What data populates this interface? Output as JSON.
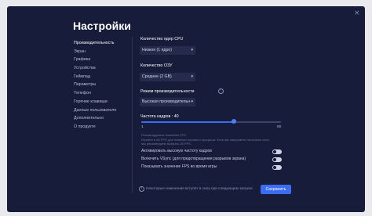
{
  "window": {
    "close_glyph": "×"
  },
  "title": "Настройки",
  "sidebar": {
    "items": [
      {
        "label": "Производительность"
      },
      {
        "label": "Экран"
      },
      {
        "label": "Графика"
      },
      {
        "label": "Устройства"
      },
      {
        "label": "Геймпад"
      },
      {
        "label": "Параметры"
      },
      {
        "label": "Телефон"
      },
      {
        "label": "Горячие клавиши"
      },
      {
        "label": "Данные пользователя"
      },
      {
        "label": "Дополнительно"
      },
      {
        "label": "О продукте"
      }
    ],
    "active_index": 0
  },
  "cpu": {
    "label": "Количество ядер CPU",
    "value": "Низкое (1 ядро)"
  },
  "ram": {
    "label": "Количество ОЗУ",
    "value": "Среднее (2 GB)"
  },
  "mode": {
    "label": "Режим производительности",
    "value": "Высокая производительн"
  },
  "fps": {
    "label": "Частота кадров : 40",
    "value": 40,
    "min": 1,
    "max": 60,
    "min_label": "1",
    "max_label": "60",
    "note_title": "Рекомендуемое значение FPS",
    "note_line1": "Играйте в 60 FPS для плавного игрового процесса. Если вы запускаете несколько окон,",
    "note_line2": "мы рекомендуем выбрать 20 FPS."
  },
  "toggles": [
    {
      "label": "Активировать высокую частоту кадров",
      "on": false
    },
    {
      "label": "Включить VSync (для предотвращения разрывов экрана)",
      "on": false
    },
    {
      "label": "Показывать значение FPS во время игры",
      "on": false
    }
  ],
  "footer": {
    "note": "Некоторые изменения вступят в силу при следующем запуске",
    "info_glyph": "!",
    "save_label": "Сохранить"
  },
  "icons": {
    "dropdown": "chevron-down-icon",
    "info": "info-icon",
    "close": "close-icon"
  },
  "colors": {
    "background": "#171c3a",
    "accent": "#3b6df2",
    "field": "#252b4d"
  }
}
